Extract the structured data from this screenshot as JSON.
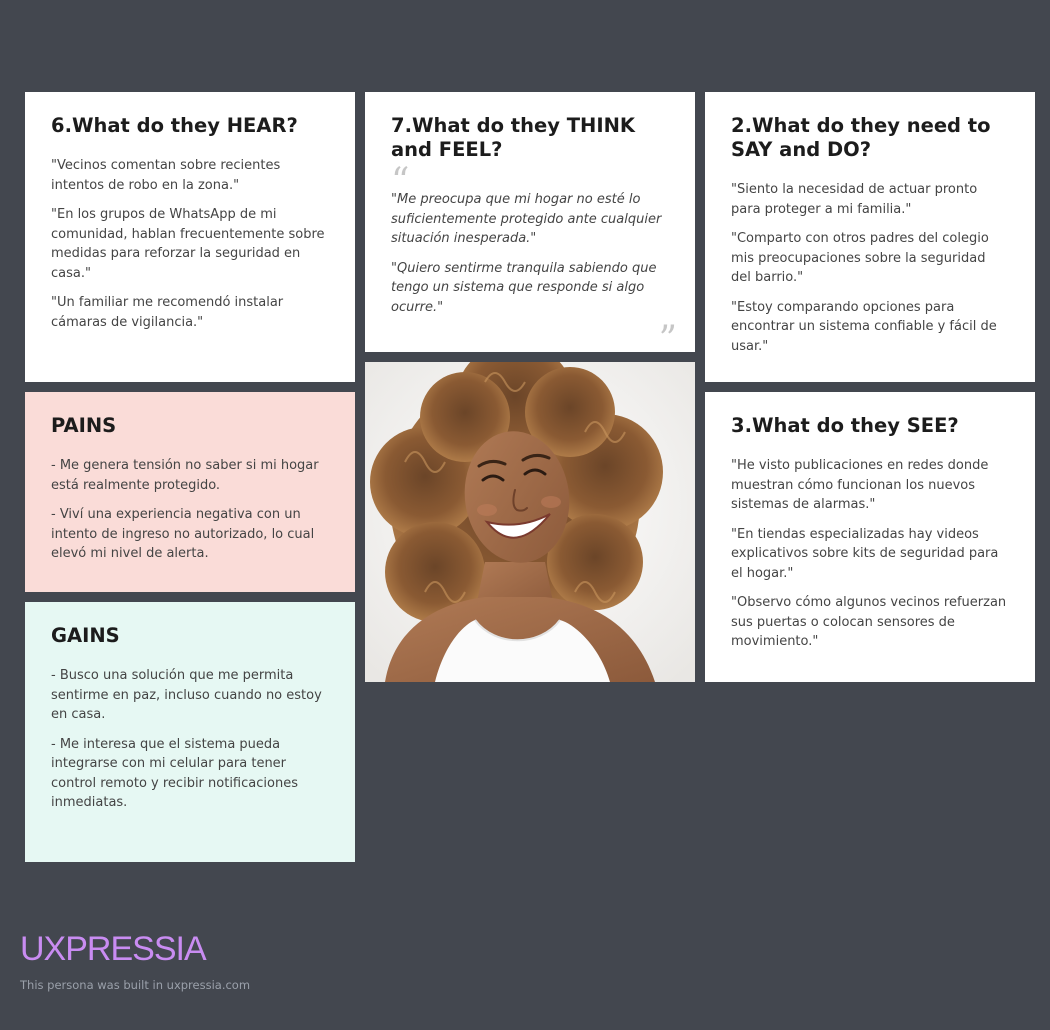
{
  "hear": {
    "title": "6.What do they HEAR?",
    "items": [
      "\"Vecinos comentan sobre recientes intentos de robo en la zona.\"",
      "\"En los grupos de WhatsApp de mi comunidad, hablan frecuentemente sobre medidas para reforzar la seguridad en casa.\"",
      "\"Un familiar me recomendó instalar cámaras de vigilancia.\""
    ]
  },
  "think": {
    "title": "7.What do they THINK and FEEL?",
    "quote_open": "“",
    "quote_close": "”",
    "items": [
      "\"Me preocupa que mi hogar no esté lo suficientemente protegido ante cualquier situación inesperada.\"",
      "\"Quiero sentirme tranquila sabiendo que tengo un sistema que responde si algo ocurre.\""
    ]
  },
  "say": {
    "title": "2.What do they need to SAY and DO?",
    "items": [
      "\"Siento la necesidad de actuar pronto para proteger a mi familia.\"",
      "\"Comparto con otros padres del colegio mis preocupaciones sobre la seguridad del barrio.\"",
      "\"Estoy comparando opciones para encontrar un sistema confiable y fácil de usar.\""
    ]
  },
  "pains": {
    "title": "PAINS",
    "items": [
      "- Me genera tensión no saber si mi hogar está realmente protegido.",
      "- Viví una experiencia negativa con un intento de ingreso no autorizado, lo cual elevó mi nivel de alerta."
    ]
  },
  "see": {
    "title": "3.What do they SEE?",
    "items": [
      "\"He visto publicaciones en redes donde muestran cómo funcionan los nuevos sistemas de alarmas.\"",
      "\"En tiendas especializadas hay videos explicativos sobre kits de seguridad para el hogar.\"",
      "\"Observo cómo algunos vecinos refuerzan sus puertas o colocan sensores de movimiento.\""
    ]
  },
  "gains": {
    "title": "GAINS",
    "items": [
      "- Busco una solución que me permita sentirme en paz, incluso cuando no estoy en casa.",
      "- Me interesa que el sistema pueda integrarse con mi celular para tener control remoto y recibir notificaciones inmediatas."
    ]
  },
  "footer": {
    "logo": "UXPRESSIA",
    "note": "This persona was built in uxpressia.com"
  },
  "colors": {
    "background": "#43474f",
    "card": "#ffffff",
    "pains_bg": "#fadcd8",
    "gains_bg": "#e6f8f3",
    "brand": "#c98cf2"
  },
  "icons": {
    "persona_photo": "smiling-woman-curly-hair-photo"
  }
}
